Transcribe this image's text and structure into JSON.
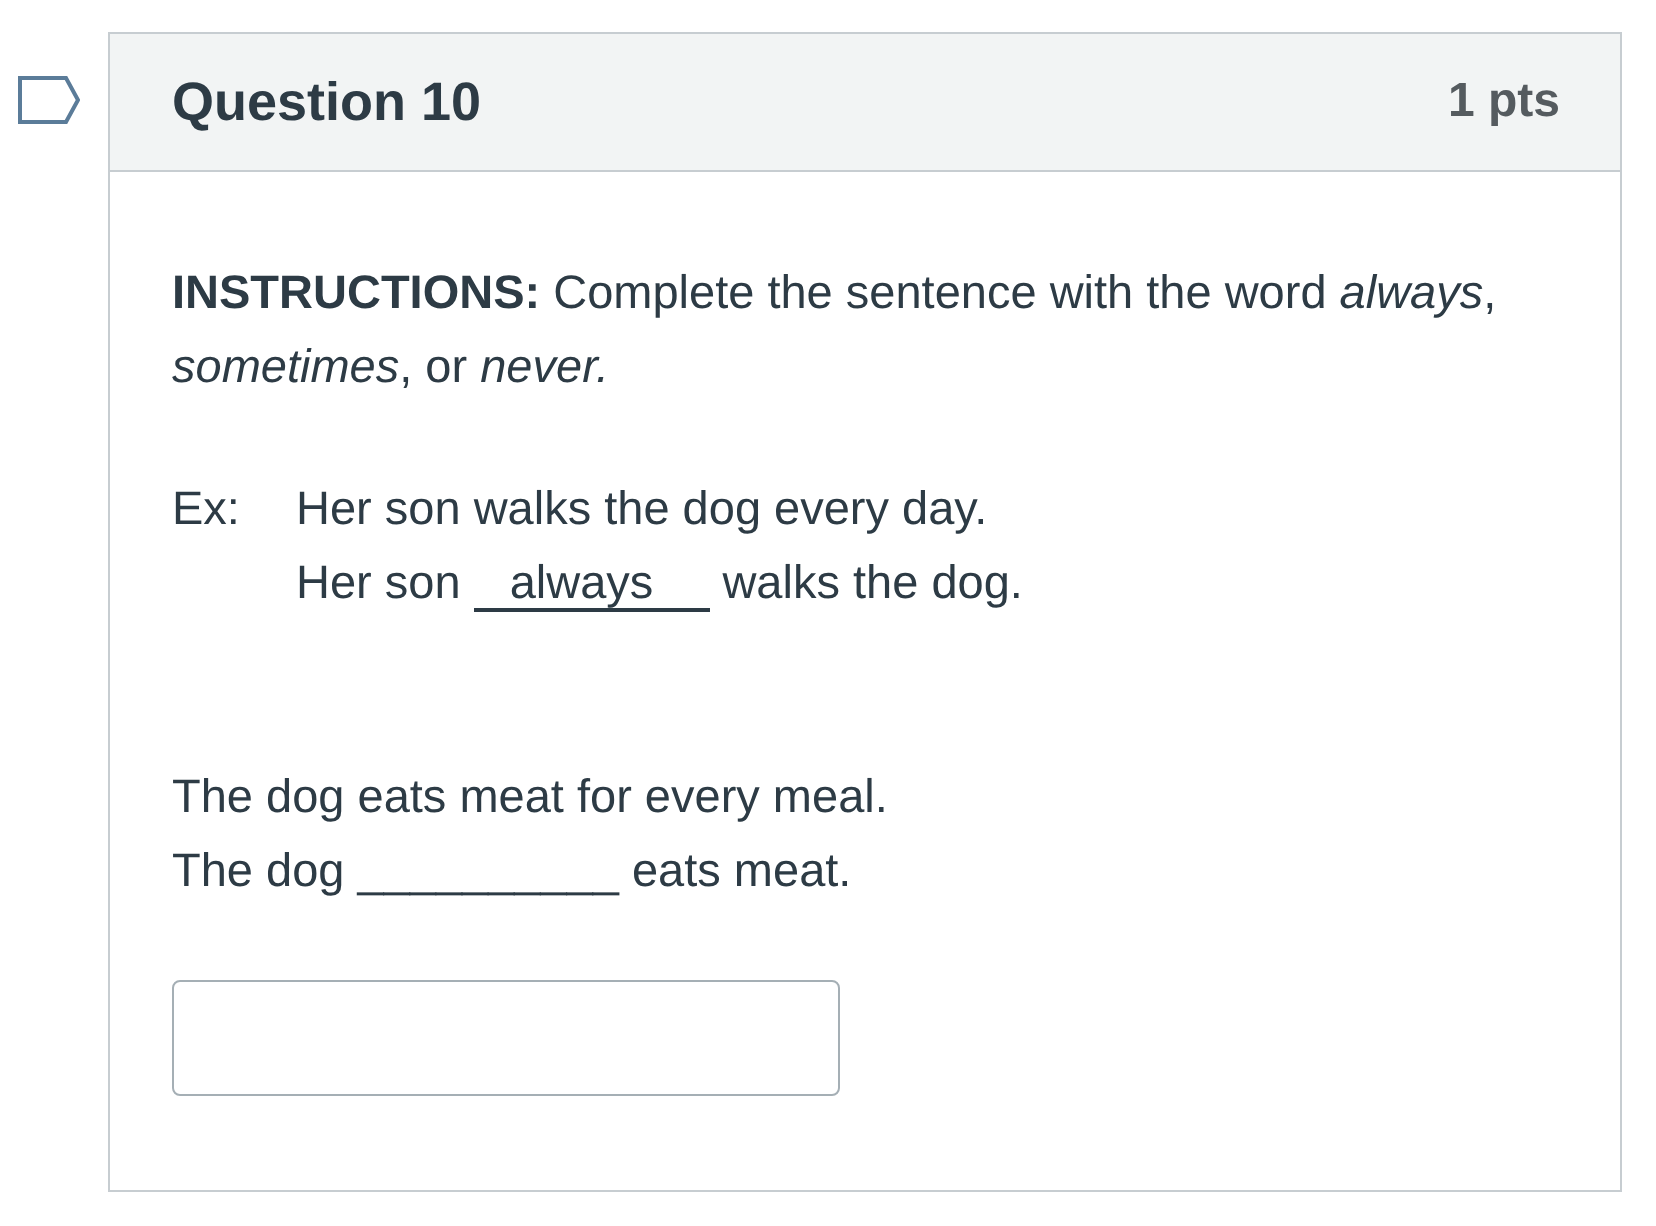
{
  "question": {
    "title": "Question 10",
    "points": "1 pts",
    "flagged": false
  },
  "instructions": "**INSTRUCTIONS:** Complete the sentence with the word *always*, *sometimes*, or *never.*",
  "example": {
    "label": "Ex:",
    "sentence": "Her son walks the dog every day.",
    "answer_sentence": {
      "before": "Her son",
      "answer": "always",
      "after": "walks the dog."
    }
  },
  "prompt": [
    "The dog eats meat for every meal.",
    "The dog __________ eats meat."
  ]
}
